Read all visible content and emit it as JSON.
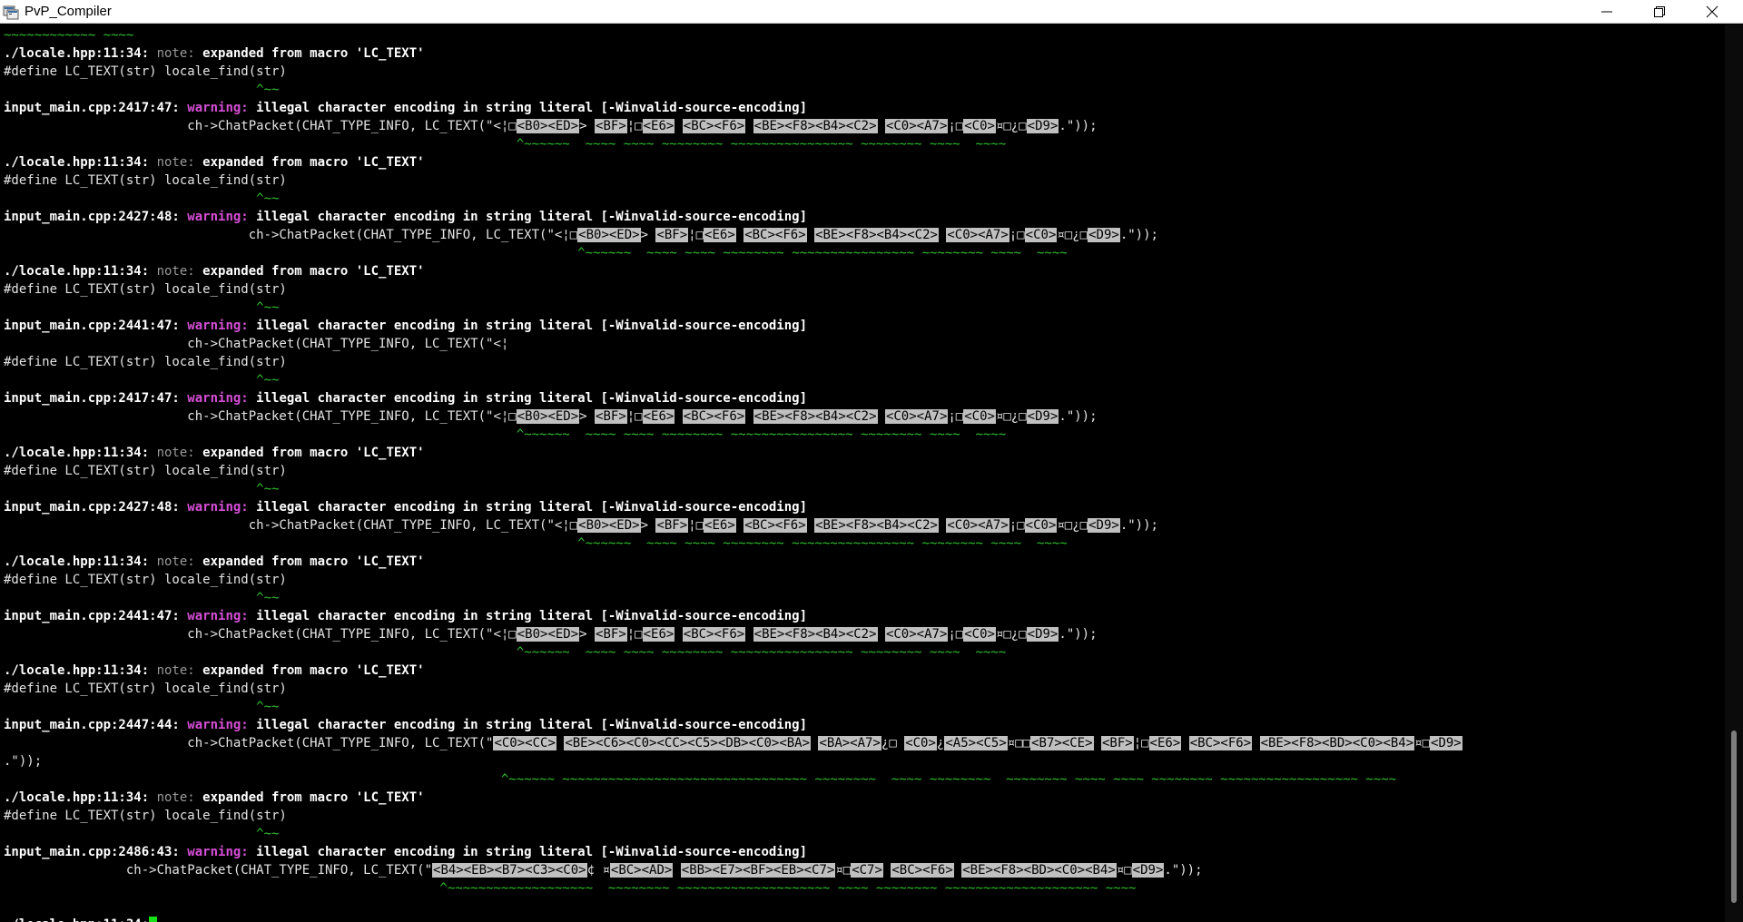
{
  "window": {
    "title": "PvP_Compiler",
    "icon": "console-app-icon",
    "controls": [
      "minimize-icon",
      "restore-icon",
      "close-icon"
    ]
  },
  "console": {
    "lines": [
      [
        {
          "t": "~~~~~~~~~~~~ ~~~~",
          "c": "gr"
        }
      ],
      [
        {
          "t": "./locale.hpp:11:34: ",
          "c": "b"
        },
        {
          "t": "note: ",
          "c": "note"
        },
        {
          "t": "expanded from macro 'LC_TEXT'",
          "c": "b"
        }
      ],
      [
        {
          "t": "#define LC_TEXT(str) locale_find(str)"
        }
      ],
      [
        {
          "t": "                                 ^~~",
          "c": "gr"
        }
      ],
      [
        {
          "t": "input_main.cpp:2417:47: ",
          "c": "b"
        },
        {
          "t": "warning: ",
          "c": "warn"
        },
        {
          "t": "illegal character encoding in string literal [-Winvalid-source-encoding]",
          "c": "b"
        }
      ],
      [
        {
          "t": "                        ch->ChatPacket(CHAT_TYPE_INFO, LC_TEXT(\"<¦□"
        },
        {
          "t": "<B0><ED>",
          "c": "hx"
        },
        {
          "t": "> "
        },
        {
          "t": "<BF>",
          "c": "hx"
        },
        {
          "t": "¦□"
        },
        {
          "t": "<E6>",
          "c": "hx"
        },
        {
          "t": " "
        },
        {
          "t": "<BC><F6>",
          "c": "hx"
        },
        {
          "t": " "
        },
        {
          "t": "<BE><F8><B4><C2>",
          "c": "hx"
        },
        {
          "t": " "
        },
        {
          "t": "<C0><A7>",
          "c": "hx"
        },
        {
          "t": "¡□"
        },
        {
          "t": "<C0>",
          "c": "hx"
        },
        {
          "t": "¤□¿□"
        },
        {
          "t": "<D9>",
          "c": "hx"
        },
        {
          "t": ".\"));"
        }
      ],
      [
        {
          "t": "                                                                   ^~~~~~~  ~~~~ ~~~~ ~~~~~~~~ ~~~~~~~~~~~~~~~~ ~~~~~~~~ ~~~~  ~~~~",
          "c": "gr"
        }
      ],
      [
        {
          "t": "./locale.hpp:11:34: ",
          "c": "b"
        },
        {
          "t": "note: ",
          "c": "note"
        },
        {
          "t": "expanded from macro 'LC_TEXT'",
          "c": "b"
        }
      ],
      [
        {
          "t": "#define LC_TEXT(str) locale_find(str)"
        }
      ],
      [
        {
          "t": "                                 ^~~",
          "c": "gr"
        }
      ],
      [
        {
          "t": "input_main.cpp:2427:48: ",
          "c": "b"
        },
        {
          "t": "warning: ",
          "c": "warn"
        },
        {
          "t": "illegal character encoding in string literal [-Winvalid-source-encoding]",
          "c": "b"
        }
      ],
      [
        {
          "t": "                                ch->ChatPacket(CHAT_TYPE_INFO, LC_TEXT(\"<¦□"
        },
        {
          "t": "<B0><ED>",
          "c": "hx"
        },
        {
          "t": "> "
        },
        {
          "t": "<BF>",
          "c": "hx"
        },
        {
          "t": "¦□"
        },
        {
          "t": "<E6>",
          "c": "hx"
        },
        {
          "t": " "
        },
        {
          "t": "<BC><F6>",
          "c": "hx"
        },
        {
          "t": " "
        },
        {
          "t": "<BE><F8><B4><C2>",
          "c": "hx"
        },
        {
          "t": " "
        },
        {
          "t": "<C0><A7>",
          "c": "hx"
        },
        {
          "t": "¡□"
        },
        {
          "t": "<C0>",
          "c": "hx"
        },
        {
          "t": "¤□¿□"
        },
        {
          "t": "<D9>",
          "c": "hx"
        },
        {
          "t": ".\"));"
        }
      ],
      [
        {
          "t": "                                                                           ^~~~~~~  ~~~~ ~~~~ ~~~~~~~~ ~~~~~~~~~~~~~~~~ ~~~~~~~~ ~~~~  ~~~~",
          "c": "gr"
        }
      ],
      [
        {
          "t": "./locale.hpp:11:34: ",
          "c": "b"
        },
        {
          "t": "note: ",
          "c": "note"
        },
        {
          "t": "expanded from macro 'LC_TEXT'",
          "c": "b"
        }
      ],
      [
        {
          "t": "#define LC_TEXT(str) locale_find(str)"
        }
      ],
      [
        {
          "t": "                                 ^~~",
          "c": "gr"
        }
      ],
      [
        {
          "t": "input_main.cpp:2441:47: ",
          "c": "b"
        },
        {
          "t": "warning: ",
          "c": "warn"
        },
        {
          "t": "illegal character encoding in string literal [-Winvalid-source-encoding]",
          "c": "b"
        }
      ],
      [
        {
          "t": "                        ch->ChatPacket(CHAT_TYPE_INFO, LC_TEXT(\"<¦"
        }
      ],
      [
        {
          "t": "#define LC_TEXT(str) locale_find(str)"
        }
      ],
      [
        {
          "t": "                                 ^~~",
          "c": "gr"
        }
      ],
      [
        {
          "t": "input_main.cpp:2417:47: ",
          "c": "b"
        },
        {
          "t": "warning: ",
          "c": "warn"
        },
        {
          "t": "illegal character encoding in string literal [-Winvalid-source-encoding]",
          "c": "b"
        }
      ],
      [
        {
          "t": "                        ch->ChatPacket(CHAT_TYPE_INFO, LC_TEXT(\"<¦□"
        },
        {
          "t": "<B0><ED>",
          "c": "hx"
        },
        {
          "t": "> "
        },
        {
          "t": "<BF>",
          "c": "hx"
        },
        {
          "t": "¦□"
        },
        {
          "t": "<E6>",
          "c": "hx"
        },
        {
          "t": " "
        },
        {
          "t": "<BC><F6>",
          "c": "hx"
        },
        {
          "t": " "
        },
        {
          "t": "<BE><F8><B4><C2>",
          "c": "hx"
        },
        {
          "t": " "
        },
        {
          "t": "<C0><A7>",
          "c": "hx"
        },
        {
          "t": "¡□"
        },
        {
          "t": "<C0>",
          "c": "hx"
        },
        {
          "t": "¤□¿□"
        },
        {
          "t": "<D9>",
          "c": "hx"
        },
        {
          "t": ".\"));"
        }
      ],
      [
        {
          "t": "                                                                   ^~~~~~~  ~~~~ ~~~~ ~~~~~~~~ ~~~~~~~~~~~~~~~~ ~~~~~~~~ ~~~~  ~~~~",
          "c": "gr"
        }
      ],
      [
        {
          "t": "./locale.hpp:11:34: ",
          "c": "b"
        },
        {
          "t": "note: ",
          "c": "note"
        },
        {
          "t": "expanded from macro 'LC_TEXT'",
          "c": "b"
        }
      ],
      [
        {
          "t": "#define LC_TEXT(str) locale_find(str)"
        }
      ],
      [
        {
          "t": "                                 ^~~",
          "c": "gr"
        }
      ],
      [
        {
          "t": "input_main.cpp:2427:48: ",
          "c": "b"
        },
        {
          "t": "warning: ",
          "c": "warn"
        },
        {
          "t": "illegal character encoding in string literal [-Winvalid-source-encoding]",
          "c": "b"
        }
      ],
      [
        {
          "t": "                                ch->ChatPacket(CHAT_TYPE_INFO, LC_TEXT(\"<¦□"
        },
        {
          "t": "<B0><ED>",
          "c": "hx"
        },
        {
          "t": "> "
        },
        {
          "t": "<BF>",
          "c": "hx"
        },
        {
          "t": "¦□"
        },
        {
          "t": "<E6>",
          "c": "hx"
        },
        {
          "t": " "
        },
        {
          "t": "<BC><F6>",
          "c": "hx"
        },
        {
          "t": " "
        },
        {
          "t": "<BE><F8><B4><C2>",
          "c": "hx"
        },
        {
          "t": " "
        },
        {
          "t": "<C0><A7>",
          "c": "hx"
        },
        {
          "t": "¡□"
        },
        {
          "t": "<C0>",
          "c": "hx"
        },
        {
          "t": "¤□¿□"
        },
        {
          "t": "<D9>",
          "c": "hx"
        },
        {
          "t": ".\"));"
        }
      ],
      [
        {
          "t": "                                                                           ^~~~~~~  ~~~~ ~~~~ ~~~~~~~~ ~~~~~~~~~~~~~~~~ ~~~~~~~~ ~~~~  ~~~~",
          "c": "gr"
        }
      ],
      [
        {
          "t": "./locale.hpp:11:34: ",
          "c": "b"
        },
        {
          "t": "note: ",
          "c": "note"
        },
        {
          "t": "expanded from macro 'LC_TEXT'",
          "c": "b"
        }
      ],
      [
        {
          "t": "#define LC_TEXT(str) locale_find(str)"
        }
      ],
      [
        {
          "t": "                                 ^~~",
          "c": "gr"
        }
      ],
      [
        {
          "t": "input_main.cpp:2441:47: ",
          "c": "b"
        },
        {
          "t": "warning: ",
          "c": "warn"
        },
        {
          "t": "illegal character encoding in string literal [-Winvalid-source-encoding]",
          "c": "b"
        }
      ],
      [
        {
          "t": "                        ch->ChatPacket(CHAT_TYPE_INFO, LC_TEXT(\"<¦□"
        },
        {
          "t": "<B0><ED>",
          "c": "hx"
        },
        {
          "t": "> "
        },
        {
          "t": "<BF>",
          "c": "hx"
        },
        {
          "t": "¦□"
        },
        {
          "t": "<E6>",
          "c": "hx"
        },
        {
          "t": " "
        },
        {
          "t": "<BC><F6>",
          "c": "hx"
        },
        {
          "t": " "
        },
        {
          "t": "<BE><F8><B4><C2>",
          "c": "hx"
        },
        {
          "t": " "
        },
        {
          "t": "<C0><A7>",
          "c": "hx"
        },
        {
          "t": "¡□"
        },
        {
          "t": "<C0>",
          "c": "hx"
        },
        {
          "t": "¤□¿□"
        },
        {
          "t": "<D9>",
          "c": "hx"
        },
        {
          "t": ".\"));"
        }
      ],
      [
        {
          "t": "                                                                   ^~~~~~~  ~~~~ ~~~~ ~~~~~~~~ ~~~~~~~~~~~~~~~~ ~~~~~~~~ ~~~~  ~~~~",
          "c": "gr"
        }
      ],
      [
        {
          "t": "./locale.hpp:11:34: ",
          "c": "b"
        },
        {
          "t": "note: ",
          "c": "note"
        },
        {
          "t": "expanded from macro 'LC_TEXT'",
          "c": "b"
        }
      ],
      [
        {
          "t": "#define LC_TEXT(str) locale_find(str)"
        }
      ],
      [
        {
          "t": "                                 ^~~",
          "c": "gr"
        }
      ],
      [
        {
          "t": "input_main.cpp:2447:44: ",
          "c": "b"
        },
        {
          "t": "warning: ",
          "c": "warn"
        },
        {
          "t": "illegal character encoding in string literal [-Winvalid-source-encoding]",
          "c": "b"
        }
      ],
      [
        {
          "t": "                        ch->ChatPacket(CHAT_TYPE_INFO, LC_TEXT(\""
        },
        {
          "t": "<C0><CC>",
          "c": "hx"
        },
        {
          "t": " "
        },
        {
          "t": "<BE><C6><C0><CC><C5><DB><C0><BA>",
          "c": "hx"
        },
        {
          "t": " "
        },
        {
          "t": "<BA><A7>",
          "c": "hx"
        },
        {
          "t": "¿□ "
        },
        {
          "t": "<C0>",
          "c": "hx"
        },
        {
          "t": "¿"
        },
        {
          "t": "<A5><C5>",
          "c": "hx"
        },
        {
          "t": "¤□□"
        },
        {
          "t": "<B7><CE>",
          "c": "hx"
        },
        {
          "t": " "
        },
        {
          "t": "<BF>",
          "c": "hx"
        },
        {
          "t": "¦□"
        },
        {
          "t": "<E6>",
          "c": "hx"
        },
        {
          "t": " "
        },
        {
          "t": "<BC><F6>",
          "c": "hx"
        },
        {
          "t": " "
        },
        {
          "t": "<BE><F8><BD><C0><B4>",
          "c": "hx"
        },
        {
          "t": "¤□"
        },
        {
          "t": "<D9>",
          "c": "hx"
        }
      ],
      [
        {
          "t": ".\"));"
        }
      ],
      [
        {
          "t": "                                                                 ^~~~~~~ ~~~~~~~~~~~~~~~~~~~~~~~~~~~~~~~~ ~~~~~~~~  ~~~~ ~~~~~~~~  ~~~~~~~~ ~~~~ ~~~~ ~~~~~~~~ ~~~~~~~~~~~~~~~~~~ ~~~~",
          "c": "gr"
        }
      ],
      [
        {
          "t": "./locale.hpp:11:34: ",
          "c": "b"
        },
        {
          "t": "note: ",
          "c": "note"
        },
        {
          "t": "expanded from macro 'LC_TEXT'",
          "c": "b"
        }
      ],
      [
        {
          "t": "#define LC_TEXT(str) locale_find(str)"
        }
      ],
      [
        {
          "t": "                                 ^~~",
          "c": "gr"
        }
      ],
      [
        {
          "t": "input_main.cpp:2486:43: ",
          "c": "b"
        },
        {
          "t": "warning: ",
          "c": "warn"
        },
        {
          "t": "illegal character encoding in string literal [-Winvalid-source-encoding]",
          "c": "b"
        }
      ],
      [
        {
          "t": "                ch->ChatPacket(CHAT_TYPE_INFO, LC_TEXT(\""
        },
        {
          "t": "<B4><EB><B7><C3><C0>",
          "c": "hx"
        },
        {
          "t": "¢ ¤"
        },
        {
          "t": "<BC><AD>",
          "c": "hx"
        },
        {
          "t": " "
        },
        {
          "t": "<BB><E7><BF><EB><C7>",
          "c": "hx"
        },
        {
          "t": "¤□"
        },
        {
          "t": "<C7>",
          "c": "hx"
        },
        {
          "t": " "
        },
        {
          "t": "<BC><F6>",
          "c": "hx"
        },
        {
          "t": " "
        },
        {
          "t": "<BE><F8><BD><C0><B4>",
          "c": "hx"
        },
        {
          "t": "¤□"
        },
        {
          "t": "<D9>",
          "c": "hx"
        },
        {
          "t": ".\"));"
        }
      ],
      [
        {
          "t": "                                                         ^~~~~~~~~~~~~~~~~~~~  ~~~~~~~~ ~~~~~~~~~~~~~~~~~~~~ ~~~~ ~~~~~~~~ ~~~~~~~~~~~~~~~~~~~~ ~~~~",
          "c": "gr"
        }
      ],
      [],
      [
        {
          "t": "./locale.hpp:11:34:",
          "c": "b"
        }
      ]
    ]
  }
}
